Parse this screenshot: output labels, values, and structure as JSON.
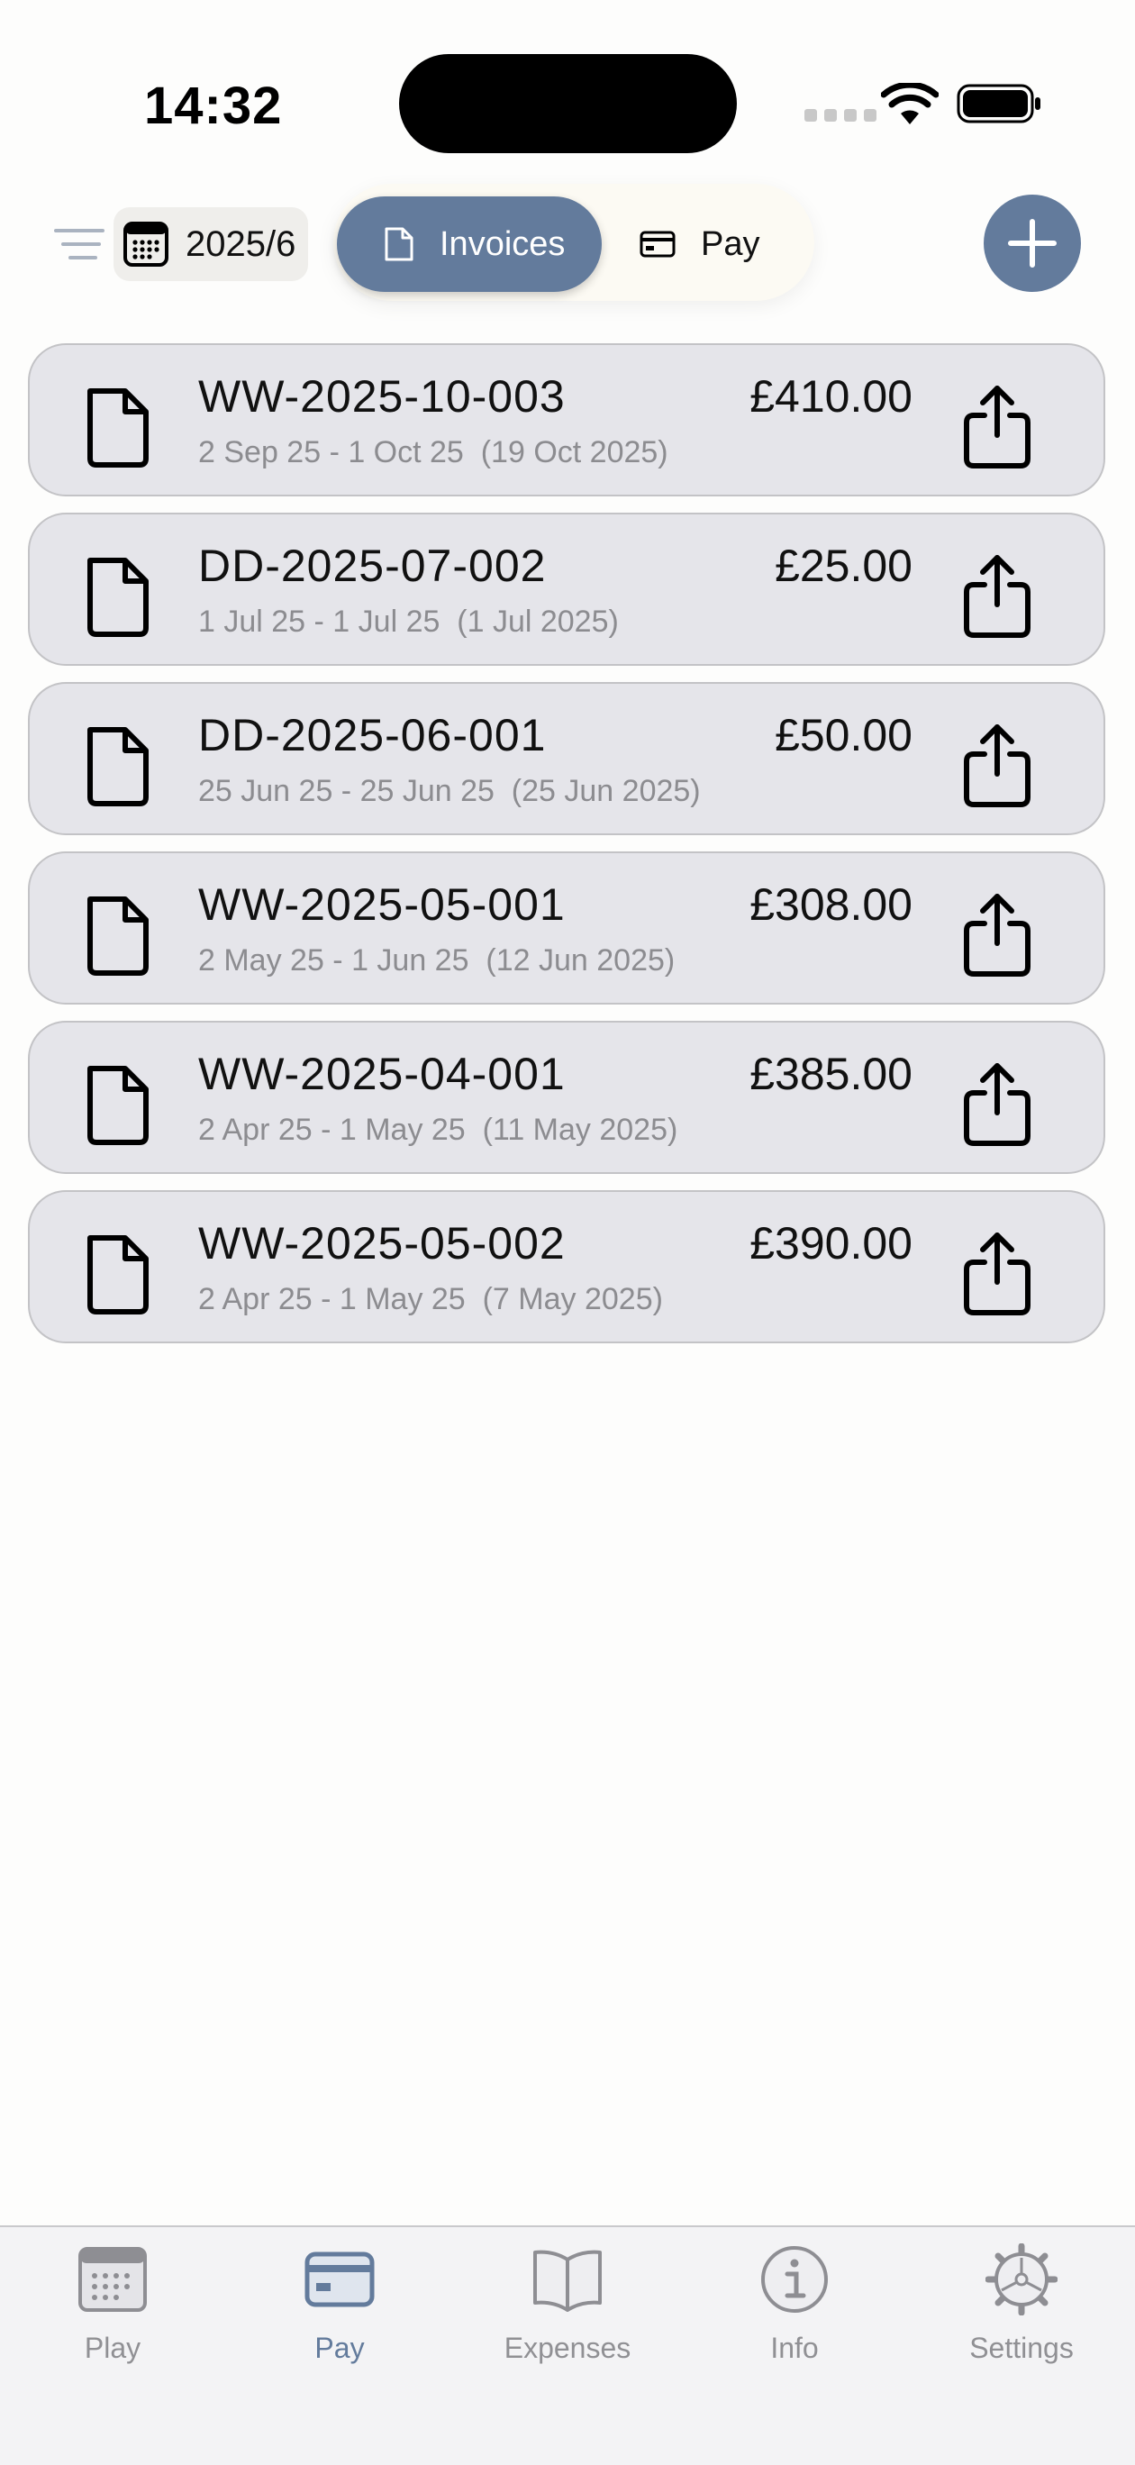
{
  "status_bar": {
    "time": "14:32"
  },
  "toolbar": {
    "date_label": "2025/6",
    "segments": [
      {
        "label": "Invoices",
        "icon": "document-icon",
        "selected": true
      },
      {
        "label": "Pay",
        "icon": "card-icon",
        "selected": false
      }
    ]
  },
  "colors": {
    "accent": "#637b9c",
    "card_background": "#e5e5ea",
    "secondary_text": "#8c8c90",
    "tab_inactive": "#909094"
  },
  "invoices": [
    {
      "number": "WW-2025-10-003",
      "amount": "£410.00",
      "dates": "2 Sep 25 - 1 Oct 25  (19 Oct 2025)"
    },
    {
      "number": "DD-2025-07-002",
      "amount": "£25.00",
      "dates": "1 Jul 25 - 1 Jul 25  (1 Jul 2025)"
    },
    {
      "number": "DD-2025-06-001",
      "amount": "£50.00",
      "dates": "25 Jun 25 - 25 Jun 25  (25 Jun 2025)"
    },
    {
      "number": "WW-2025-05-001",
      "amount": "£308.00",
      "dates": "2 May 25 - 1 Jun 25  (12 Jun 2025)"
    },
    {
      "number": "WW-2025-04-001",
      "amount": "£385.00",
      "dates": "2 Apr 25 - 1 May 25  (11 May 2025)"
    },
    {
      "number": "WW-2025-05-002",
      "amount": "£390.00",
      "dates": "2 Apr 25 - 1 May 25  (7 May 2025)"
    }
  ],
  "tab_bar": {
    "tabs": [
      {
        "label": "Play",
        "icon": "calendar-icon",
        "active": false
      },
      {
        "label": "Pay",
        "icon": "card-icon",
        "active": true
      },
      {
        "label": "Expenses",
        "icon": "book-icon",
        "active": false
      },
      {
        "label": "Info",
        "icon": "info-icon",
        "active": false
      },
      {
        "label": "Settings",
        "icon": "gear-icon",
        "active": false
      }
    ]
  }
}
